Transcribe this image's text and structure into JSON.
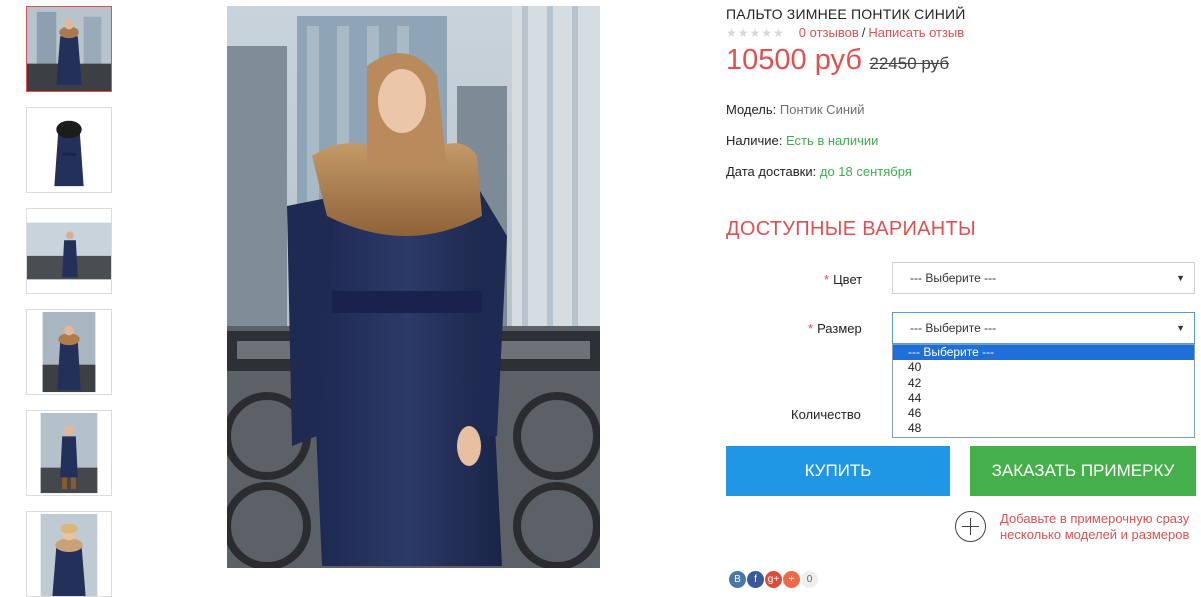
{
  "product": {
    "title": "ПАЛЬТО ЗИМНЕЕ ПОНТИК СИНИЙ",
    "stars": "★★★★★",
    "reviews_link": "0 отзывов",
    "separator": "/",
    "write_review_link": "Написать отзыв",
    "price_new": "10500 руб",
    "price_old": "22450 руб"
  },
  "details": {
    "model_label": "Модель:",
    "model_value": "Понтик Синий",
    "stock_label": "Наличие:",
    "stock_value": "Есть в наличии",
    "delivery_label": "Дата доставки:",
    "delivery_value": "до 18 сентября"
  },
  "options": {
    "section_title": "ДОСТУПНЫЕ ВАРИАНТЫ",
    "required_mark": "*",
    "color_label": "Цвет",
    "color_value": "--- Выберите ---",
    "size_label": "Размер",
    "size_value": "--- Выберите ---",
    "size_options": [
      "--- Выберите ---",
      "40",
      "42",
      "44",
      "46",
      "48"
    ],
    "quantity_label": "Количество"
  },
  "actions": {
    "buy_label": "КУПИТЬ",
    "fitting_label": "ЗАКАЗАТЬ ПРИМЕРКУ",
    "fitting_note": "Добавьте в примерочную сразу несколько моделей и размеров"
  },
  "share": {
    "vk": "B",
    "fb": "f",
    "gplus": "g+",
    "more": "+",
    "count": "0"
  },
  "colors": {
    "accent_red": "#e05050",
    "buy_blue": "#1f97e5",
    "fit_green": "#45b04a",
    "stock_green": "#3fae49",
    "coat_navy": "#22305a"
  }
}
